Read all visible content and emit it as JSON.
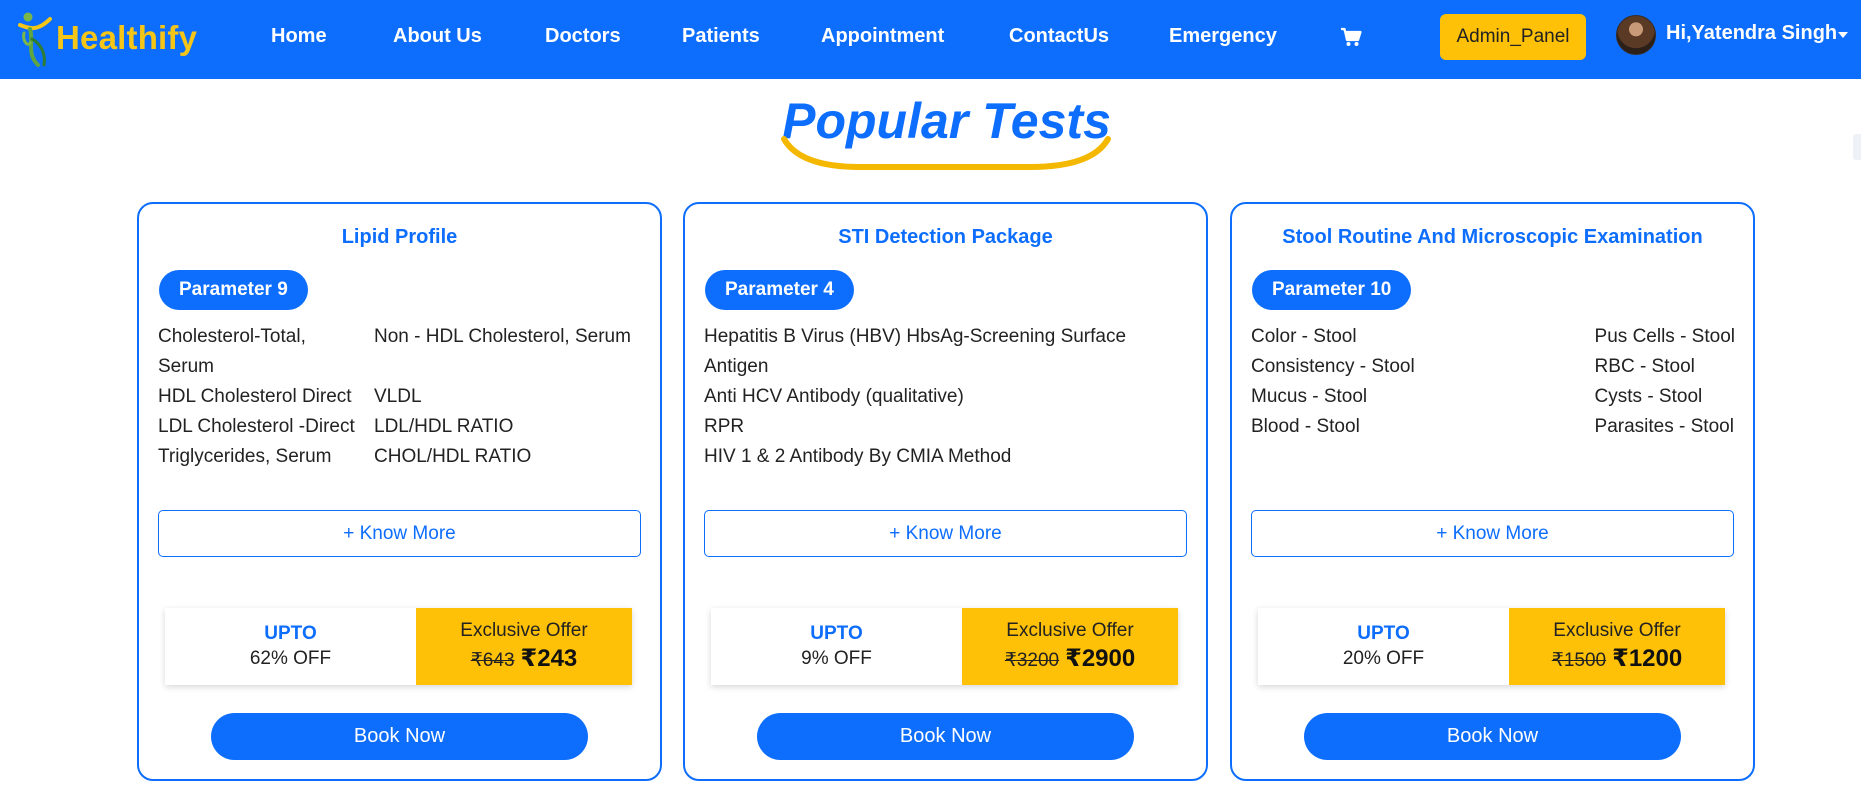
{
  "brand": {
    "name": "Healthify",
    "logo_icon": "person-leaf-logo-icon",
    "text_color": "#f5c518"
  },
  "nav": {
    "items": [
      {
        "label": "Home"
      },
      {
        "label": "About Us"
      },
      {
        "label": "Doctors"
      },
      {
        "label": "Patients"
      },
      {
        "label": "Appointment"
      },
      {
        "label": "ContactUs"
      },
      {
        "label": "Emergency"
      }
    ],
    "cart_icon": "cart-icon",
    "admin_label": "Admin_Panel",
    "user_greeting": "Hi,Yatendra Singh",
    "user_caret_icon": "caret-down-icon"
  },
  "section": {
    "title": "Popular Tests"
  },
  "cards": [
    {
      "title": "Lipid Profile",
      "parameter_label": "Parameter 9",
      "parameters": [
        "Cholesterol-Total, Serum",
        "Non - HDL Cholesterol, Serum",
        "HDL Cholesterol Direct",
        "VLDL",
        "LDL Cholesterol -Direct",
        "LDL/HDL RATIO",
        "Triglycerides, Serum",
        "CHOL/HDL RATIO"
      ],
      "know_more": "+ Know More",
      "upto": "UPTO",
      "discount": "62% OFF",
      "offer_label": "Exclusive Offer",
      "old_price": "₹643",
      "new_price": "₹243",
      "book_label": "Book Now"
    },
    {
      "title": "STI Detection Package",
      "parameter_label": "Parameter 4",
      "parameters": [
        "Hepatitis B Virus (HBV) HbsAg-Screening Surface Antigen",
        "Anti HCV Antibody (qualitative)",
        "RPR",
        "HIV 1 & 2 Antibody By CMIA Method"
      ],
      "know_more": "+ Know More",
      "upto": "UPTO",
      "discount": "9% OFF",
      "offer_label": "Exclusive Offer",
      "old_price": "₹3200",
      "new_price": "₹2900",
      "book_label": "Book Now"
    },
    {
      "title": "Stool Routine And Microscopic Examination",
      "parameter_label": "Parameter 10",
      "parameters": [
        "Color - Stool",
        "Pus Cells - Stool",
        "Consistency - Stool",
        "RBC - Stool",
        "Mucus - Stool",
        "Cysts - Stool",
        "Blood - Stool",
        "Parasites - Stool"
      ],
      "know_more": "+ Know More",
      "upto": "UPTO",
      "discount": "20% OFF",
      "offer_label": "Exclusive Offer",
      "old_price": "₹1500",
      "new_price": "₹1200",
      "book_label": "Book Now"
    }
  ],
  "colors": {
    "primary": "#0d6efd",
    "accent": "#ffc107",
    "white": "#ffffff"
  }
}
